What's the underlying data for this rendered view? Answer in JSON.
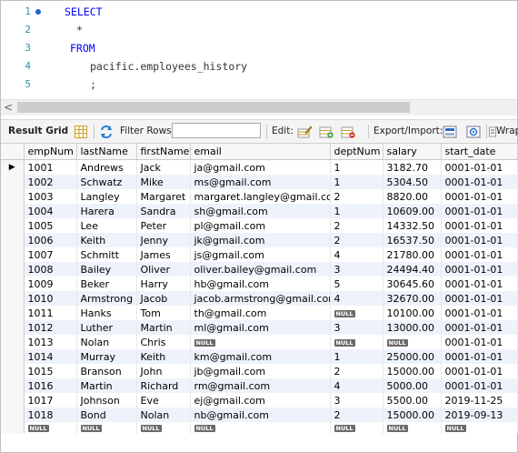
{
  "editor": {
    "lines": [
      {
        "num": "1",
        "text": "SELECT",
        "keyword": true
      },
      {
        "num": "2",
        "text": "*",
        "keyword": false
      },
      {
        "num": "3",
        "text": "FROM",
        "keyword": true
      },
      {
        "num": "4",
        "text": "pacific.employees_history",
        "keyword": false
      },
      {
        "num": "5",
        "text": ";",
        "keyword": false
      }
    ],
    "keyword_color": "#0000ff",
    "line_number_color": "#2b91af"
  },
  "scrollbar": {
    "left_arrow": "<"
  },
  "toolbar": {
    "result_grid_label": "Result Grid",
    "filter_rows_label": "Filter Rows:",
    "filter_value": "",
    "edit_label": "Edit:",
    "export_import_label": "Export/Import:",
    "wrap_label": "Wrap",
    "icons": [
      "grid-toggle-icon",
      "refresh-icon",
      "edit-row-icon",
      "add-row-icon",
      "delete-row-icon",
      "export-icon",
      "import-icon",
      "wrap-cell-icon"
    ]
  },
  "grid": {
    "columns": [
      "empNum",
      "lastName",
      "firstName",
      "email",
      "deptNum",
      "salary",
      "start_date"
    ],
    "current_row_marker": "▶",
    "null_label": "NULL",
    "rows": [
      [
        "1001",
        "Andrews",
        "Jack",
        "ja@gmail.com",
        "1",
        "3182.70",
        "0001-01-01"
      ],
      [
        "1002",
        "Schwatz",
        "Mike",
        "ms@gmail.com",
        "1",
        "5304.50",
        "0001-01-01"
      ],
      [
        "1003",
        "Langley",
        "Margaret",
        "margaret.langley@gmail.com",
        "2",
        "8820.00",
        "0001-01-01"
      ],
      [
        "1004",
        "Harera",
        "Sandra",
        "sh@gmail.com",
        "1",
        "10609.00",
        "0001-01-01"
      ],
      [
        "1005",
        "Lee",
        "Peter",
        "pl@gmail.com",
        "2",
        "14332.50",
        "0001-01-01"
      ],
      [
        "1006",
        "Keith",
        "Jenny",
        "jk@gmail.com",
        "2",
        "16537.50",
        "0001-01-01"
      ],
      [
        "1007",
        "Schmitt",
        "James",
        "js@gmail.com",
        "4",
        "21780.00",
        "0001-01-01"
      ],
      [
        "1008",
        "Bailey",
        "Oliver",
        "oliver.bailey@gmail.com",
        "3",
        "24494.40",
        "0001-01-01"
      ],
      [
        "1009",
        "Beker",
        "Harry",
        "hb@gmail.com",
        "5",
        "30645.60",
        "0001-01-01"
      ],
      [
        "1010",
        "Armstrong",
        "Jacob",
        "jacob.armstrong@gmail.com",
        "4",
        "32670.00",
        "0001-01-01"
      ],
      [
        "1011",
        "Hanks",
        "Tom",
        "th@gmail.com",
        null,
        "10100.00",
        "0001-01-01"
      ],
      [
        "1012",
        "Luther",
        "Martin",
        "ml@gmail.com",
        "3",
        "13000.00",
        "0001-01-01"
      ],
      [
        "1013",
        "Nolan",
        "Chris",
        null,
        null,
        null,
        "0001-01-01"
      ],
      [
        "1014",
        "Murray",
        "Keith",
        "km@gmail.com",
        "1",
        "25000.00",
        "0001-01-01"
      ],
      [
        "1015",
        "Branson",
        "John",
        "jb@gmail.com",
        "2",
        "15000.00",
        "0001-01-01"
      ],
      [
        "1016",
        "Martin",
        "Richard",
        "rm@gmail.com",
        "4",
        "5000.00",
        "0001-01-01"
      ],
      [
        "1017",
        "Johnson",
        "Eve",
        "ej@gmail.com",
        "3",
        "5500.00",
        "2019-11-25"
      ],
      [
        "1018",
        "Bond",
        "Nolan",
        "nb@gmail.com",
        "2",
        "15000.00",
        "2019-09-13"
      ]
    ]
  }
}
